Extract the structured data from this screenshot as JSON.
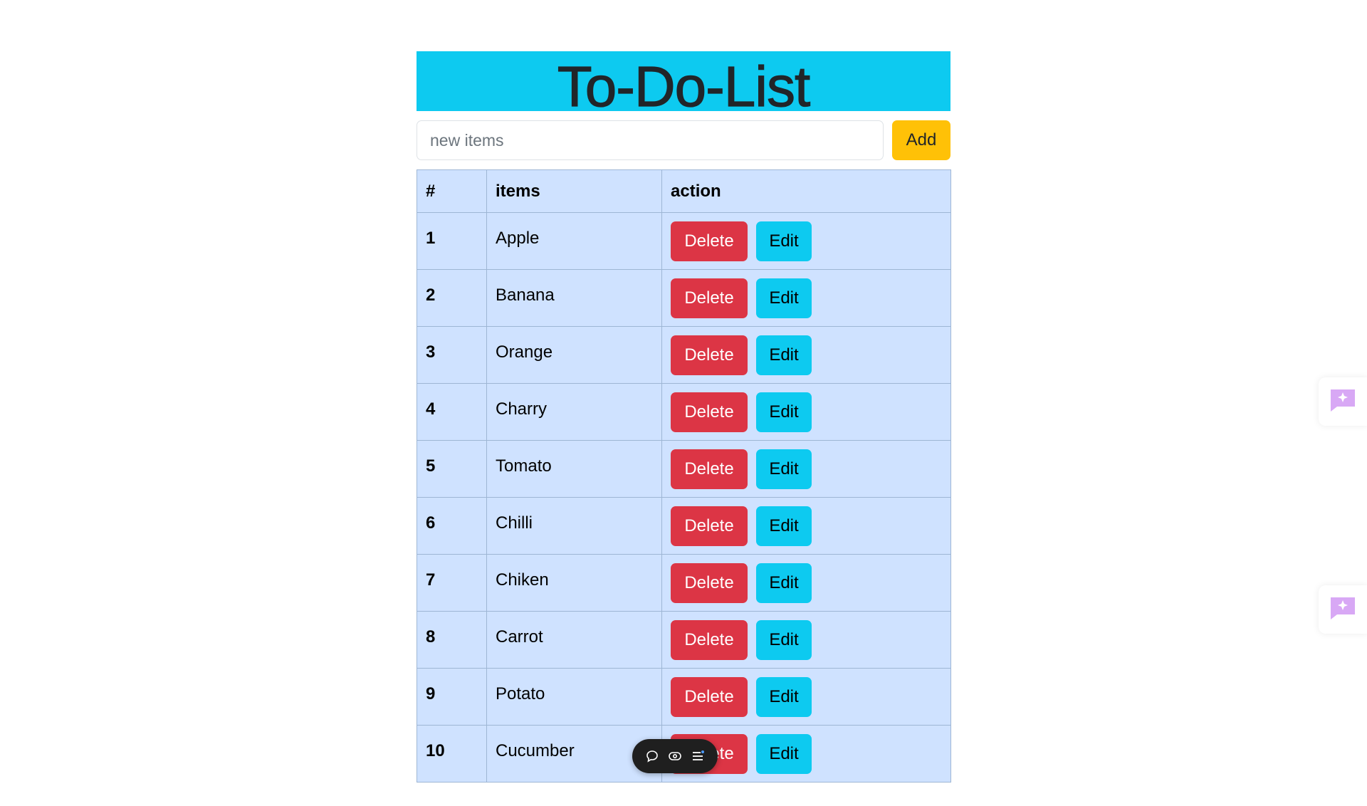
{
  "header": {
    "title": "To-Do-List"
  },
  "add_form": {
    "placeholder": "new items",
    "add_label": "Add"
  },
  "table": {
    "headers": [
      "#",
      "items",
      "action"
    ],
    "rows": [
      {
        "num": "1",
        "item": "Apple"
      },
      {
        "num": "2",
        "item": "Banana"
      },
      {
        "num": "3",
        "item": "Orange"
      },
      {
        "num": "4",
        "item": "Charry"
      },
      {
        "num": "5",
        "item": "Tomato"
      },
      {
        "num": "6",
        "item": "Chilli"
      },
      {
        "num": "7",
        "item": "Chiken"
      },
      {
        "num": "8",
        "item": "Carrot"
      },
      {
        "num": "9",
        "item": "Potato"
      },
      {
        "num": "10",
        "item": "Cucumber"
      }
    ],
    "delete_label": "Delete",
    "edit_label": "Edit"
  },
  "toolbar": {
    "icons": [
      "chat-bubble-icon",
      "eye-icon",
      "menu-icon"
    ]
  },
  "side_widgets": [
    "ai-chat-sparkle-icon",
    "ai-chat-sparkle-icon"
  ],
  "colors": {
    "banner": "#0dcaf0",
    "add_button": "#ffc107",
    "delete_button": "#dc3545",
    "edit_button": "#0dcaf0",
    "table_bg": "#cfe2ff",
    "toolbar_bg": "#1f1f1f",
    "sparkle": "#c084fc"
  }
}
